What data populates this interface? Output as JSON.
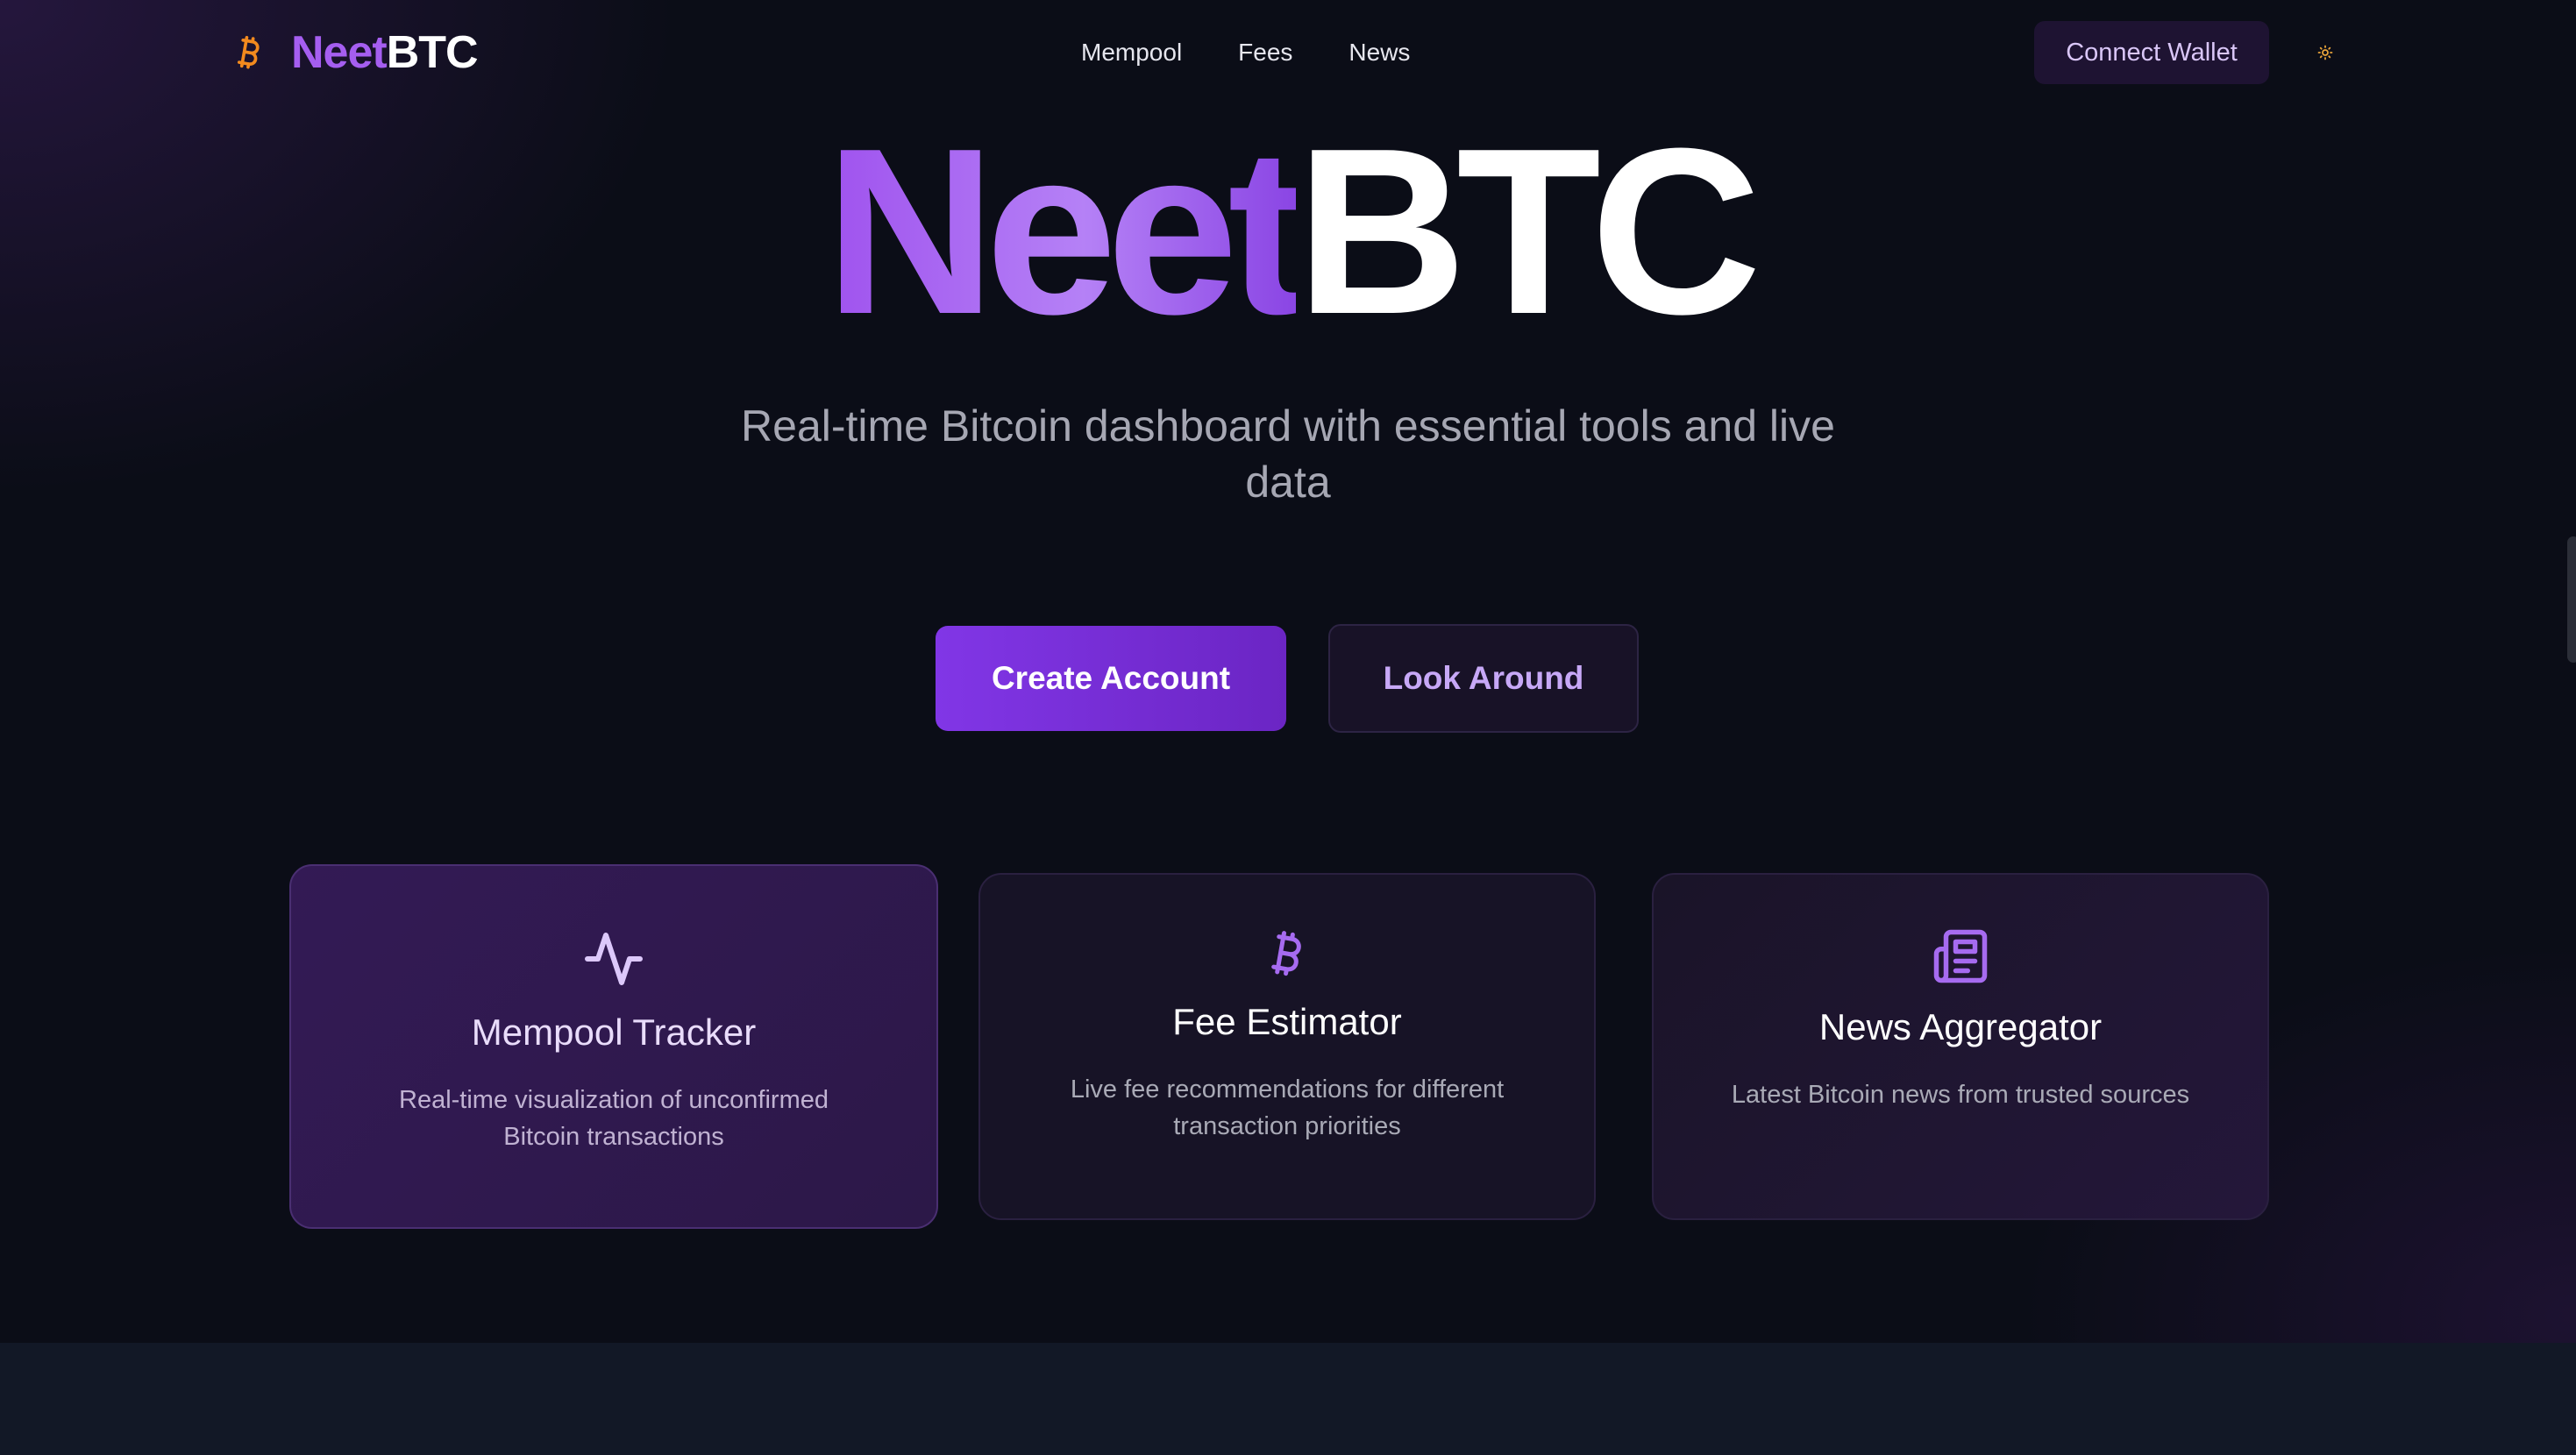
{
  "nav": {
    "brand": {
      "part1": "Neet",
      "part2": "BTC",
      "icon": "bitcoin-icon"
    },
    "links": [
      {
        "label": "Mempool"
      },
      {
        "label": "Fees"
      },
      {
        "label": "News"
      }
    ],
    "connect_wallet": "Connect Wallet",
    "theme_toggle_icon": "sun-icon"
  },
  "hero": {
    "title_part1": "Neet",
    "title_part2": "BTC",
    "subtitle": "Real-time Bitcoin dashboard with essential tools and live data",
    "primary_cta": "Create Account",
    "secondary_cta": "Look Around"
  },
  "features": [
    {
      "icon": "activity-icon",
      "title": "Mempool Tracker",
      "description": "Real-time visualization of unconfirmed Bitcoin transactions"
    },
    {
      "icon": "bitcoin-icon",
      "title": "Fee Estimator",
      "description": "Live fee recommendations for different transaction priorities"
    },
    {
      "icon": "newspaper-icon",
      "title": "News Aggregator",
      "description": "Latest Bitcoin news from trusted sources"
    }
  ],
  "colors": {
    "background": "#0b0d17",
    "brand_purple": "#a55ef0",
    "bitcoin_orange": "#f28a1e",
    "accent_button": "#7c33e0",
    "text_muted": "#a6a7b3"
  }
}
